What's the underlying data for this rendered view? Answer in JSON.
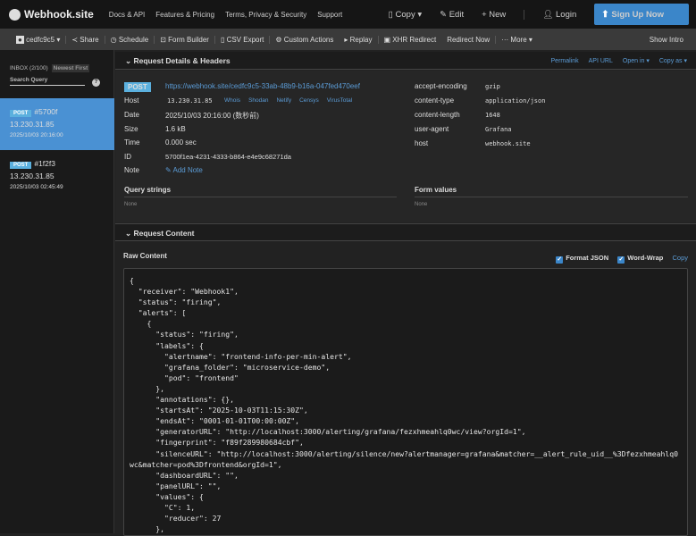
{
  "nav": {
    "brand": "Webhook.site",
    "links": [
      "Docs & API",
      "Features & Pricing",
      "Terms, Privacy & Security",
      "Support"
    ],
    "copy": "Copy ▾",
    "edit": "Edit",
    "new": "+ New",
    "login": "Login",
    "signup": "Sign Up Now"
  },
  "toolbar": {
    "token": "cedfc9c5 ▾",
    "share": "Share",
    "schedule": "Schedule",
    "form_builder": "Form Builder",
    "csv_export": "CSV Export",
    "custom_actions": "Custom Actions",
    "replay": "Replay",
    "xhr_redirect": "XHR Redirect",
    "redirect_now": "Redirect Now",
    "more": "More ▾",
    "show_info": "Show Intro"
  },
  "sidebar": {
    "inbox": "INBOX (2/100)",
    "sort": "Newest First",
    "search_placeholder": "Search Query",
    "requests": [
      {
        "method": "POST",
        "id": "#5700f",
        "ip": "13.230.31.85",
        "date": "2025/10/03 20:16:00"
      },
      {
        "method": "POST",
        "id": "#1f2f3",
        "ip": "13.230.31.85",
        "date": "2025/10/03 02:45:49"
      }
    ]
  },
  "details": {
    "title": "Request Details & Headers",
    "links": [
      "Permalink",
      "API URL",
      "Open in ▾",
      "Copy as ▾"
    ],
    "method": "POST",
    "url": "https://webhook.site/cedfc9c5-33ab-48b9-b16a-047fed470eef",
    "host_label": "Host",
    "host": "13.230.31.85",
    "host_links": [
      "Whois",
      "Shodan",
      "Netify",
      "Censys",
      "VirusTotal"
    ],
    "date_label": "Date",
    "date": "2025/10/03 20:16:00 (数秒前)",
    "size_label": "Size",
    "size": "1.6 kB",
    "time_label": "Time",
    "time": "0.000 sec",
    "id_label": "ID",
    "id": "5700f1ea-4231-4333-b864-e4e9c68271da",
    "note_label": "Note",
    "add_note": "Add Note",
    "query_title": "Query strings",
    "query_none": "None",
    "form_title": "Form values",
    "form_none": "None",
    "headers": [
      {
        "k": "accept-encoding",
        "v": "gzip"
      },
      {
        "k": "content-type",
        "v": "application/json"
      },
      {
        "k": "content-length",
        "v": "1648"
      },
      {
        "k": "user-agent",
        "v": "Grafana"
      },
      {
        "k": "host",
        "v": "webhook.site"
      }
    ]
  },
  "content": {
    "title": "Request Content",
    "raw": "Raw Content",
    "format_json": "Format JSON",
    "word_wrap": "Word-Wrap",
    "copy": "Copy",
    "body": "{\n  \"receiver\": \"Webhook1\",\n  \"status\": \"firing\",\n  \"alerts\": [\n    {\n      \"status\": \"firing\",\n      \"labels\": {\n        \"alertname\": \"frontend-info-per-min-alert\",\n        \"grafana_folder\": \"microservice-demo\",\n        \"pod\": \"frontend\"\n      },\n      \"annotations\": {},\n      \"startsAt\": \"2025-10-03T11:15:30Z\",\n      \"endsAt\": \"0001-01-01T00:00:00Z\",\n      \"generatorURL\": \"http://localhost:3000/alerting/grafana/fezxhmeahlq0wc/view?orgId=1\",\n      \"fingerprint\": \"f89f289980684cbf\",\n      \"silenceURL\": \"http://localhost:3000/alerting/silence/new?alertmanager=grafana&matcher=__alert_rule_uid__%3Dfezxhmeahlq0wc&matcher=pod%3Dfrontend&orgId=1\",\n      \"dashboardURL\": \"\",\n      \"panelURL\": \"\",\n      \"values\": {\n        \"C\": 1,\n        \"reducer\": 27\n      },"
  }
}
